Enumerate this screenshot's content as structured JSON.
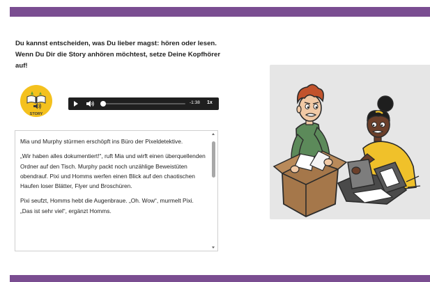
{
  "intro_text": "Du kannst entscheiden, was Du lieber magst: hören oder lesen. Wenn Du Dir die Story anhören möchtest, setze Deine Kopfhörer auf!",
  "badge": {
    "label": "STORY"
  },
  "audio_player": {
    "remaining_time": "-1:38",
    "speed": "1x",
    "progress": 0.0
  },
  "story": {
    "paragraphs": [
      "Mia und Murphy stürmen erschöpft ins Büro der Pixeldetektive.",
      "„Wir haben alles dokumentiert!“, ruft Mia und wirft einen überquellenden Ordner auf den Tisch. Murphy packt noch unzählige Beweistüten obendrauf. Pixi und Homms werfen einen Blick auf den chaotischen Haufen loser Blätter, Flyer und Broschüren.",
      "Pixi seufzt, Homms hebt die Augenbraue. „Oh. Wow“, murmelt Pixi. „Das ist sehr viel“, ergänzt Homms."
    ]
  },
  "colors": {
    "brand_purple": "#7a4d91",
    "badge_yellow": "#f4c11e",
    "player_bg": "#1f1f1f"
  }
}
